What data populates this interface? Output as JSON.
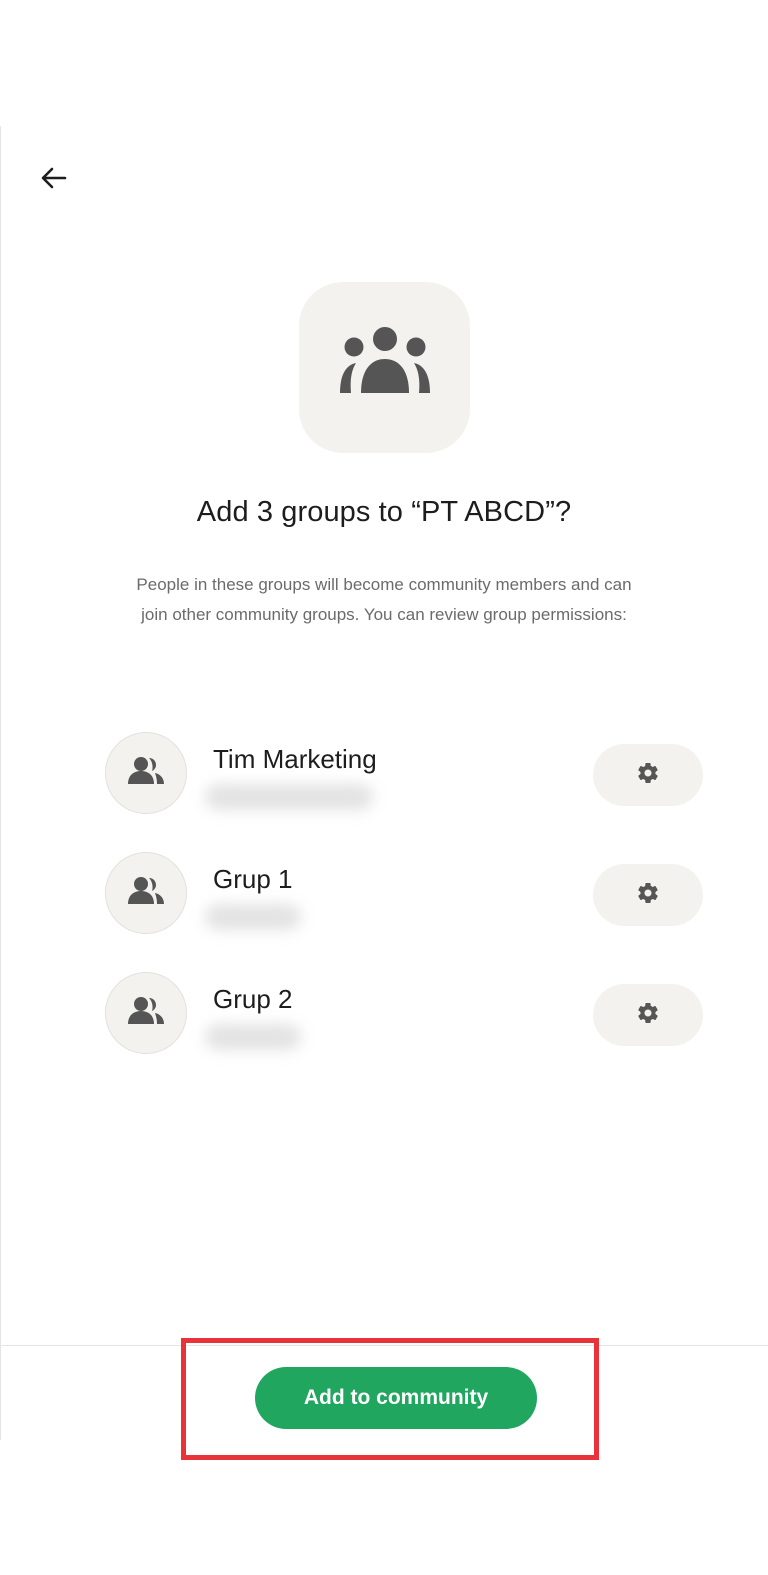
{
  "header": {
    "back_icon": "arrow-left-icon"
  },
  "hero": {
    "icon": "community-group-icon",
    "title": "Add 3 groups to “PT ABCD”?",
    "description": "People in these groups will become community members and can join other community groups. You can review group permissions:"
  },
  "groups": [
    {
      "name": "Tim Marketing",
      "avatar_icon": "group-people-icon",
      "settings_icon": "gear-icon"
    },
    {
      "name": "Grup 1",
      "avatar_icon": "group-people-icon",
      "settings_icon": "gear-icon"
    },
    {
      "name": "Grup 2",
      "avatar_icon": "group-people-icon",
      "settings_icon": "gear-icon"
    }
  ],
  "footer": {
    "primary_label": "Add to community"
  },
  "colors": {
    "accent": "#21a65f",
    "highlight": "#e8333a",
    "tile_bg": "#f4f2ef",
    "icon_gray": "#555555"
  }
}
